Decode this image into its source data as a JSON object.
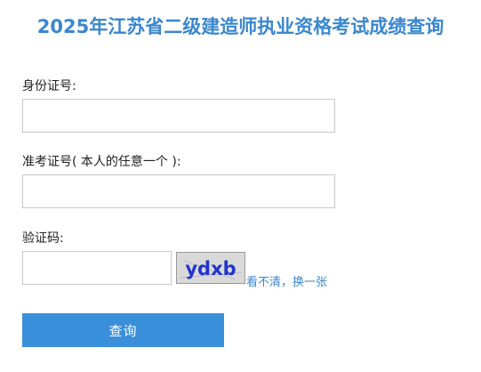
{
  "page": {
    "title": "2025年江苏省二级建造师执业资格考试成绩查询"
  },
  "form": {
    "id_number": {
      "label": "身份证号:",
      "value": ""
    },
    "admission_number": {
      "label": "准考证号( 本人的任意一个 ):",
      "value": ""
    },
    "captcha": {
      "label": "验证码:",
      "value": "",
      "image_text": "ydxb",
      "refresh_label": "看不清，换一张"
    },
    "submit_label": "查询"
  },
  "colors": {
    "title": "#3a87cf",
    "button": "#3a8fdb",
    "link": "#3a87cf",
    "captcha_text": "#2233cc"
  }
}
